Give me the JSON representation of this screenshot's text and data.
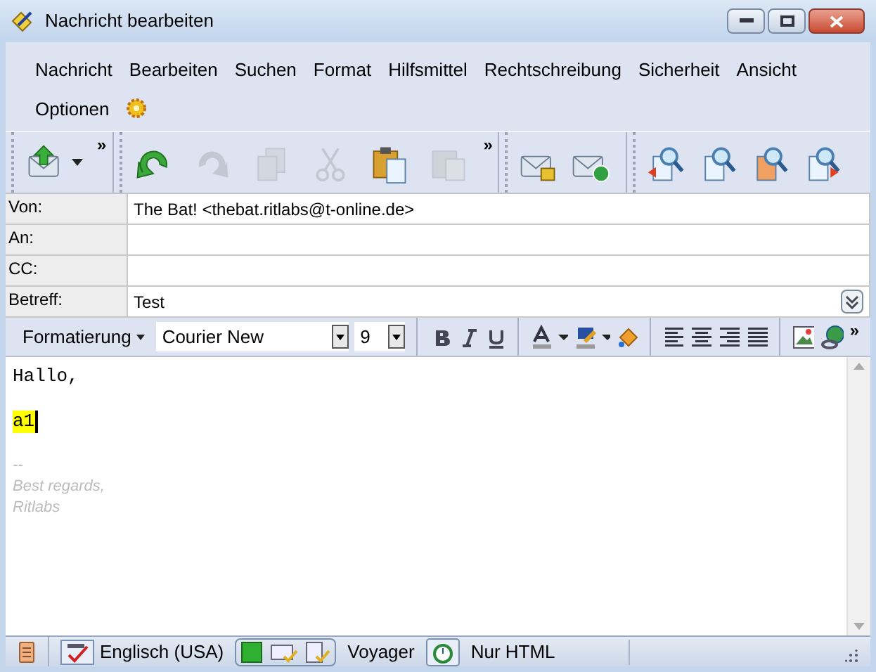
{
  "window": {
    "title": "Nachricht bearbeiten"
  },
  "menu": [
    "Nachricht",
    "Bearbeiten",
    "Suchen",
    "Format",
    "Hilfsmittel",
    "Rechtschreibung",
    "Sicherheit",
    "Ansicht",
    "Optionen"
  ],
  "toolbar": {
    "more": "»",
    "groups": [
      [
        {
          "kind": "send",
          "disabled": false,
          "dropdown": true
        }
      ],
      [
        {
          "kind": "undo",
          "disabled": false
        },
        {
          "kind": "redo",
          "disabled": true
        },
        {
          "kind": "copy",
          "disabled": true
        },
        {
          "kind": "cut",
          "disabled": true
        },
        {
          "kind": "paste",
          "disabled": false
        },
        {
          "kind": "paste-special",
          "disabled": true
        }
      ],
      [
        {
          "kind": "encrypt",
          "disabled": false
        },
        {
          "kind": "sign",
          "disabled": false
        }
      ],
      [
        {
          "kind": "find-left",
          "disabled": false
        },
        {
          "kind": "find",
          "disabled": false
        },
        {
          "kind": "find-message",
          "disabled": false
        },
        {
          "kind": "find-right",
          "disabled": false
        }
      ]
    ]
  },
  "headers": [
    {
      "label": "Von:",
      "value": "The Bat! <thebat.ritlabs@t-online.de>"
    },
    {
      "label": "An:"
    },
    {
      "label": "CC:"
    },
    {
      "label": "Betreff:",
      "value": "Test",
      "expand": true
    }
  ],
  "format_bar": {
    "style": "Formatierung",
    "font": "Courier New",
    "size": "9",
    "more": "»"
  },
  "body": [
    {
      "kind": "text",
      "text": "Hallo,"
    },
    {
      "kind": "blank"
    },
    {
      "kind": "highlight",
      "text": "a1"
    },
    {
      "kind": "blank"
    },
    {
      "kind": "signature",
      "text": "--"
    },
    {
      "kind": "signature",
      "text": "Best regards,"
    },
    {
      "kind": "signature",
      "text": "Ritlabs"
    }
  ],
  "status_bar": {
    "language": "Englisch (USA)",
    "template": "Voyager",
    "format": "Nur HTML"
  }
}
